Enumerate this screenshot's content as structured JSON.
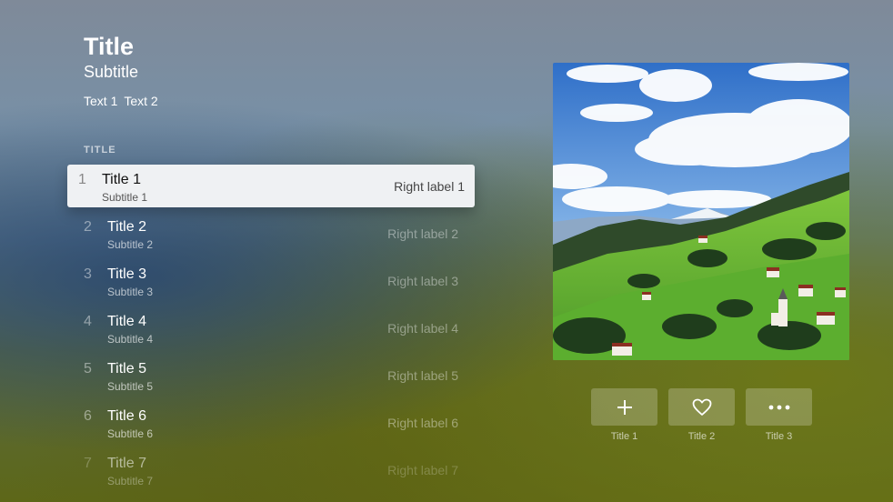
{
  "header": {
    "title": "Title",
    "subtitle": "Subtitle",
    "text1": "Text 1",
    "text2": "Text 2"
  },
  "section_title": "TITLE",
  "list": [
    {
      "num": "1",
      "title": "Title 1",
      "subtitle": "Subtitle 1",
      "right": "Right label 1",
      "focused": true
    },
    {
      "num": "2",
      "title": "Title 2",
      "subtitle": "Subtitle 2",
      "right": "Right label 2"
    },
    {
      "num": "3",
      "title": "Title 3",
      "subtitle": "Subtitle 3",
      "right": "Right label 3"
    },
    {
      "num": "4",
      "title": "Title 4",
      "subtitle": "Subtitle 4",
      "right": "Right label 4"
    },
    {
      "num": "5",
      "title": "Title 5",
      "subtitle": "Subtitle 5",
      "right": "Right label 5"
    },
    {
      "num": "6",
      "title": "Title 6",
      "subtitle": "Subtitle 6",
      "right": "Right label 6"
    },
    {
      "num": "7",
      "title": "Title 7",
      "subtitle": "Subtitle 7",
      "right": "Right label 7"
    }
  ],
  "actions": [
    {
      "icon": "plus-icon",
      "label": "Title 1"
    },
    {
      "icon": "heart-icon",
      "label": "Title 2"
    },
    {
      "icon": "more-icon",
      "label": "Title 3"
    }
  ],
  "colors": {
    "focused_row_bg": "#eff1f3",
    "button_bg": "rgba(255,255,255,0.22)"
  }
}
